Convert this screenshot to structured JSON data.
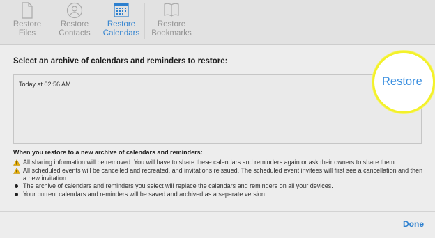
{
  "toolbar": {
    "tabs": [
      {
        "label": "Restore\nFiles",
        "icon": "document-icon",
        "active": false
      },
      {
        "label": "Restore\nContacts",
        "icon": "contact-icon",
        "active": false
      },
      {
        "label": "Restore\nCalendars",
        "icon": "calendar-icon",
        "active": true
      },
      {
        "label": "Restore\nBookmarks",
        "icon": "book-icon",
        "active": false
      }
    ]
  },
  "main": {
    "prompt": "Select an archive of calendars and reminders to restore:",
    "archives": [
      {
        "label": "Today at 02:56 AM"
      }
    ],
    "restore_label": "Restore",
    "info_title": "When you restore to a new archive of calendars and reminders:",
    "info_items": [
      {
        "type": "warning",
        "text": "All sharing information will be removed. You will have to share these calendars and reminders again or ask their owners to share them."
      },
      {
        "type": "warning",
        "text": "All scheduled events will be cancelled and recreated, and invitations reissued. The scheduled event invitees will first see a cancellation and then a new invitation."
      },
      {
        "type": "bullet",
        "text": "The archive of calendars and reminders you select will replace the calendars and reminders on all your devices."
      },
      {
        "type": "bullet",
        "text": "Your current calendars and reminders will be saved and archived as a separate version."
      }
    ]
  },
  "footer": {
    "done_label": "Done"
  },
  "colors": {
    "accent": "#2f86d8",
    "highlight_ring": "#f3f12a",
    "warning": "#f2b705"
  }
}
